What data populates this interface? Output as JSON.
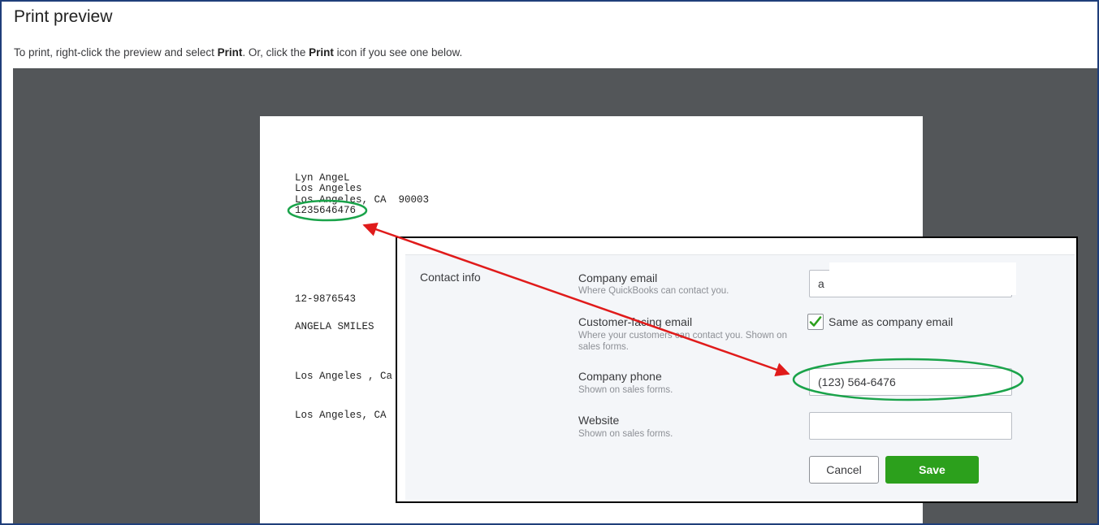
{
  "header": {
    "title": "Print preview",
    "instruction_parts": {
      "p1": "To print, right-click the preview and select ",
      "b1": "Print",
      "p2": ". Or, click the ",
      "b2": "Print",
      "p3": " icon if you see one below."
    }
  },
  "preview": {
    "address_lines": [
      "Lyn AngeL",
      "Los Angeles",
      "Los Angeles, CA  90003",
      "1235646476"
    ],
    "ein": "12-9876543",
    "recipient_name": "ANGELA SMILES",
    "city_line_1": "Los Angeles , Ca",
    "city_line_2": "Los Angeles, CA"
  },
  "contact_form": {
    "section_label": "Contact info",
    "company_email": {
      "label": "Company email",
      "hint": "Where QuickBooks can contact you.",
      "value": "a"
    },
    "customer_email": {
      "label": "Customer-facing email",
      "hint": "Where your customers can contact you. Shown on sales forms.",
      "checkbox_checked": true,
      "checkbox_label": "Same as company email"
    },
    "company_phone": {
      "label": "Company phone",
      "hint": "Shown on sales forms.",
      "value": "(123) 564-6476"
    },
    "website": {
      "label": "Website",
      "hint": "Shown on sales forms.",
      "value": ""
    },
    "buttons": {
      "cancel": "Cancel",
      "save": "Save"
    }
  },
  "annotations": {
    "highlight_color": "#1aa34a",
    "arrow_color": "#e01b1b"
  },
  "colors": {
    "preview_background": "#535659",
    "save_button": "#2ca01c",
    "checkmark": "#2ca01c",
    "frame_border": "#1f3e7a"
  }
}
